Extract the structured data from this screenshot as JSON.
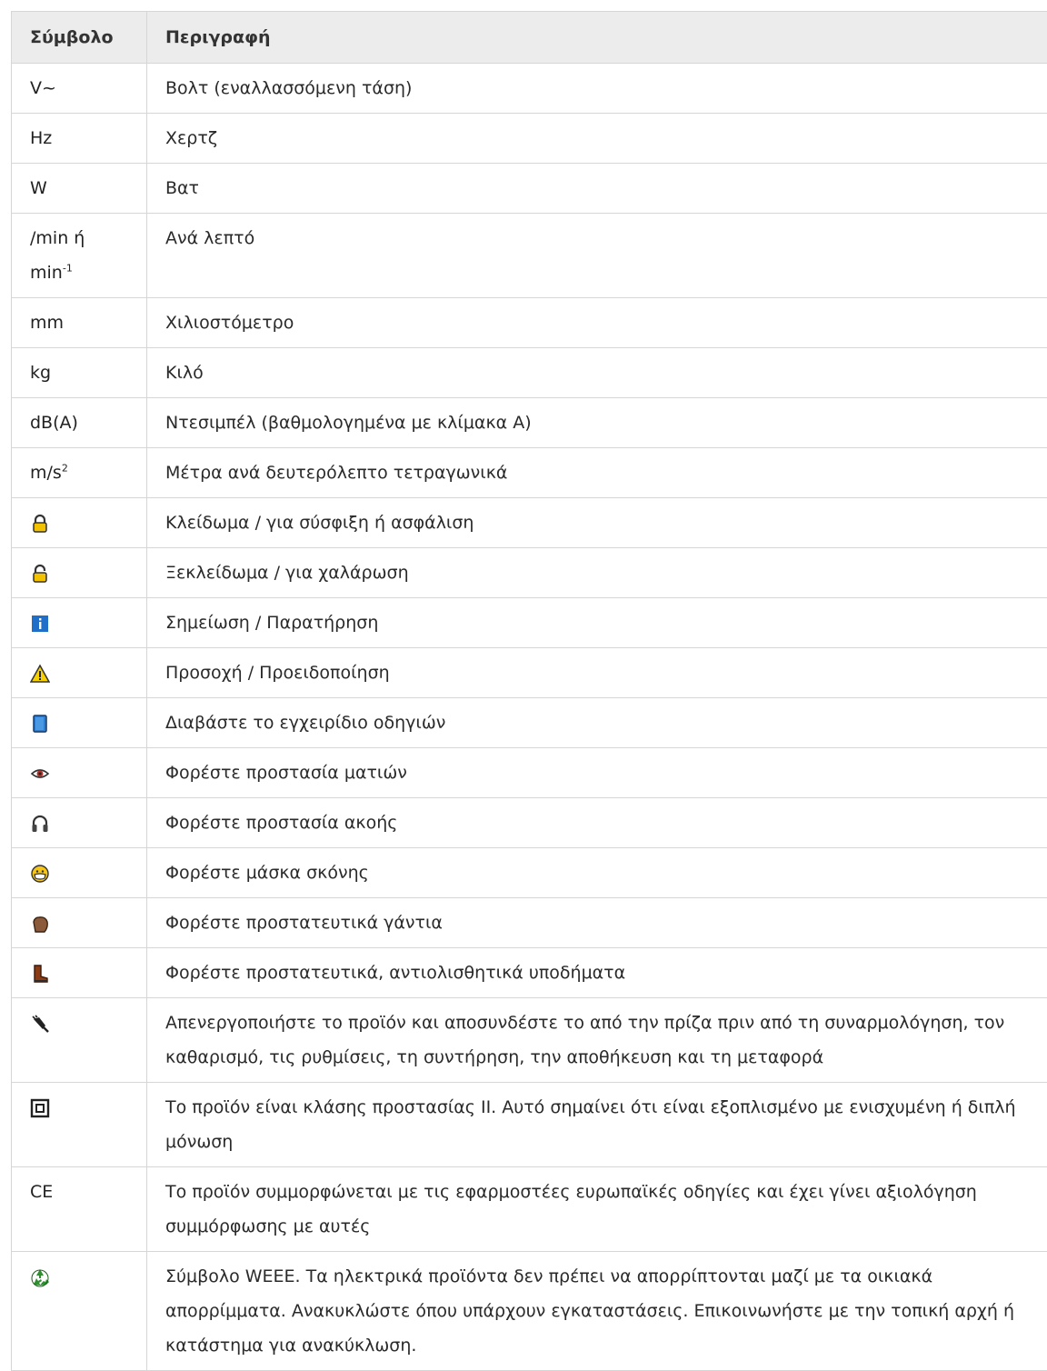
{
  "table": {
    "header": {
      "symbol": "Σύμβολο",
      "description": "Περιγραφή"
    },
    "rows": [
      {
        "symbol": "V~",
        "description": "Βολτ (εναλλασσόμενη τάση)"
      },
      {
        "symbol": "Hz",
        "description": "Χερτζ"
      },
      {
        "symbol": "W",
        "description": "Βατ"
      },
      {
        "symbol": "/min ή",
        "symbol_line2": "min",
        "symbol_sup": "-1",
        "description": "Ανά λεπτό"
      },
      {
        "symbol": "mm",
        "description": "Χιλιοστόμετρο"
      },
      {
        "symbol": "kg",
        "description": "Κιλό"
      },
      {
        "symbol": "dB(A)",
        "description": "Ντεσιμπέλ (βαθμολογημένα με κλίμακα A)"
      },
      {
        "symbol": "m/s",
        "symbol_sup": "2",
        "description": "Μέτρα ανά δευτερόλεπτο τετραγωνικά"
      },
      {
        "icon": "lock-icon",
        "description": "Κλείδωμα / για σύσφιξη ή ασφάλιση"
      },
      {
        "icon": "unlock-icon",
        "description": "Ξεκλείδωμα / για χαλάρωση"
      },
      {
        "icon": "info-icon",
        "description": "Σημείωση / Παρατήρηση"
      },
      {
        "icon": "warning-icon",
        "description": "Προσοχή / Προειδοποίηση"
      },
      {
        "icon": "manual-icon",
        "description": "Διαβάστε το εγχειρίδιο οδηγιών"
      },
      {
        "icon": "eye-protection-icon",
        "description": "Φορέστε προστασία ματιών"
      },
      {
        "icon": "hearing-protection-icon",
        "description": "Φορέστε προστασία ακοής"
      },
      {
        "icon": "dust-mask-icon",
        "description": "Φορέστε μάσκα σκόνης"
      },
      {
        "icon": "gloves-icon",
        "description": "Φορέστε προστατευτικά γάντια"
      },
      {
        "icon": "boots-icon",
        "description": "Φορέστε προστατευτικά, αντιολισθητικά υποδήματα"
      },
      {
        "icon": "unplug-icon",
        "description": "Απενεργοποιήστε το προϊόν και αποσυνδέστε το από την πρίζα πριν από τη συναρμολόγηση, τον καθαρισμό, τις ρυθμίσεις, τη συντήρηση, την αποθήκευση και τη μεταφορά"
      },
      {
        "icon": "class-ii-icon",
        "description": "Το προϊόν είναι κλάσης προστασίας II. Αυτό σημαίνει ότι είναι εξοπλισμένο με ενισχυμένη ή διπλή μόνωση"
      },
      {
        "symbol": "CE",
        "description": "Το προϊόν συμμορφώνεται με τις εφαρμοστέες ευρωπαϊκές οδηγίες και έχει γίνει αξιολόγηση συμμόρφωσης με αυτές"
      },
      {
        "icon": "recycle-icon",
        "description": "Σύμβολο WEEE. Τα ηλεκτρικά προϊόντα δεν πρέπει να απορρίπτονται μαζί με τα οικιακά απορρίμματα. Ανακυκλώστε όπου υπάρχουν εγκαταστάσεις. Επικοινωνήστε με την τοπική αρχή ή κατάστημα για ανακύκλωση."
      }
    ]
  }
}
